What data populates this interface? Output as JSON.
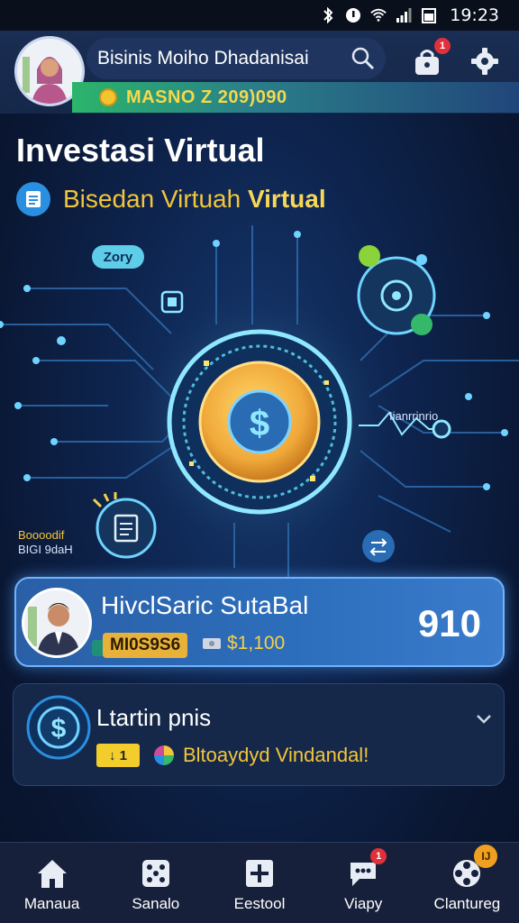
{
  "status_bar": {
    "time": "19:23",
    "icons": [
      "bluetooth-icon",
      "alarm-icon",
      "wifi-icon",
      "signal-icon",
      "battery-icon"
    ]
  },
  "header": {
    "search_text": "Bisinis Moiho Dhadanisai",
    "balance_text": "MASNO Z 209)090",
    "notification_badge": "1"
  },
  "page": {
    "title": "Investasi Virtual",
    "subtitle_prefix": "Bisedan Virtuah",
    "subtitle_highlight": "Virtual"
  },
  "hero": {
    "pill": "Zory",
    "graph_label": "Iianrrinrio",
    "side_label_1": "Boooodif",
    "side_label_2": "BIGI 9daH"
  },
  "card1": {
    "name": "HivclSaric SutaBal",
    "tag": "MI0S9S6",
    "amount": "$1,100",
    "score": "910"
  },
  "card2": {
    "title": "Ltartin pnis",
    "tag": "↓ 1",
    "text": "Bltoaydyd Vindandal!"
  },
  "nav": [
    {
      "label": "Manaua",
      "icon": "home-icon"
    },
    {
      "label": "Sanalo",
      "icon": "dice-icon"
    },
    {
      "label": "Eestool",
      "icon": "plus-box-icon"
    },
    {
      "label": "Viapy",
      "icon": "chat-icon",
      "badge": "1"
    },
    {
      "label": "Clantureg",
      "icon": "film-reel-icon",
      "badge": "IJ"
    }
  ],
  "colors": {
    "accent_gold": "#f3c53a",
    "accent_blue": "#2d6fbd",
    "background": "#0e2550",
    "badge_red": "#e0303a"
  }
}
